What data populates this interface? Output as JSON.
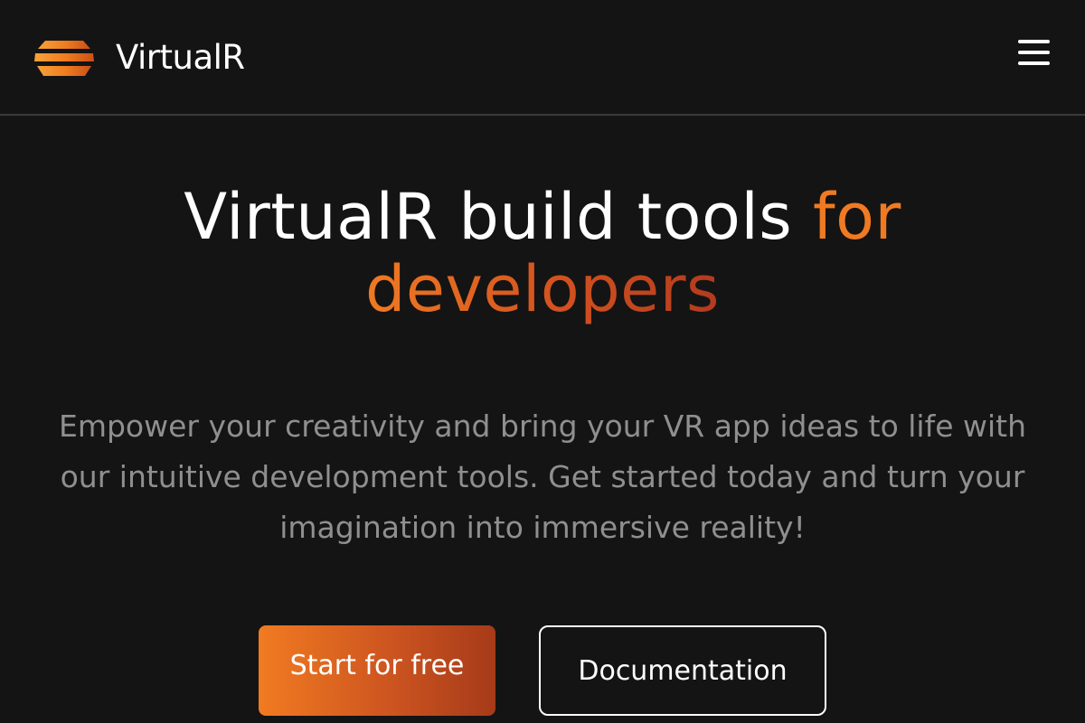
{
  "header": {
    "logo_icon": "layered-stripes-logo-icon",
    "brand": "VirtualR",
    "menu_icon": "hamburger-menu-icon"
  },
  "hero": {
    "title_main": "VirtualR build tools ",
    "title_accent_1": "for",
    "title_accent_2": "developers",
    "description": "Empower your creativity and bring your VR app ideas to life with our intuitive development tools. Get started today and turn your imagination into immersive reality!",
    "primary_button_label": "Start for free",
    "secondary_button_label": "Documentation"
  },
  "colors": {
    "background": "#141414",
    "accent_start": "#f07a22",
    "accent_end": "#a63a19",
    "text": "#ffffff",
    "muted_text": "#8f8f8f"
  }
}
